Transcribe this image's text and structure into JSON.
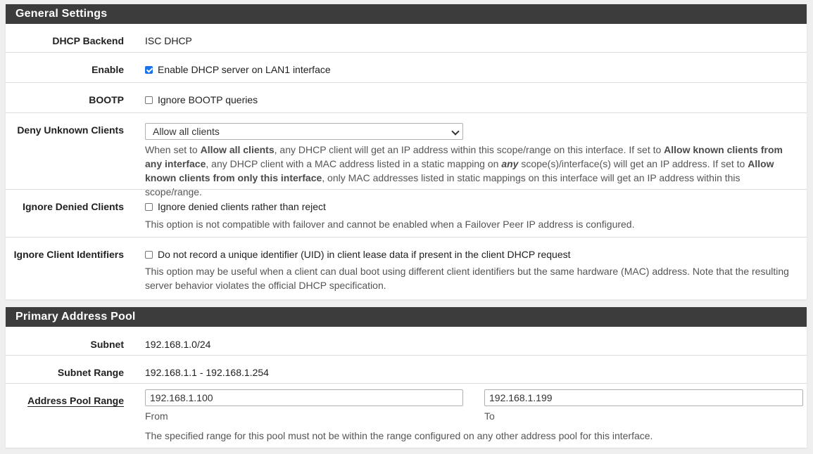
{
  "general": {
    "heading": "General Settings",
    "backend": {
      "label": "DHCP Backend",
      "value": "ISC DHCP"
    },
    "enable": {
      "label": "Enable",
      "checkbox_label": "Enable DHCP server on LAN1 interface",
      "checked": true
    },
    "bootp": {
      "label": "BOOTP",
      "checkbox_label": "Ignore BOOTP queries",
      "checked": false
    },
    "deny_unknown": {
      "label": "Deny Unknown Clients",
      "selected": "Allow all clients",
      "help": {
        "t1": "When set to ",
        "b1": "Allow all clients",
        "t2": ", any DHCP client will get an IP address within this scope/range on this interface. If set to ",
        "b2": "Allow known clients from any interface",
        "t3": ", any DHCP client with a MAC address listed in a static mapping on ",
        "b3": "any",
        "t4": " scope(s)/interface(s) will get an IP address. If set to ",
        "b4": "Allow known clients from only this interface",
        "t5": ", only MAC addresses listed in static mappings on this interface will get an IP address within this scope/range."
      }
    },
    "ignore_denied": {
      "label": "Ignore Denied Clients",
      "checkbox_label": "Ignore denied clients rather than reject",
      "checked": false,
      "help": "This option is not compatible with failover and cannot be enabled when a Failover Peer IP address is configured."
    },
    "ignore_client_ids": {
      "label": "Ignore Client Identifiers",
      "checkbox_label": "Do not record a unique identifier (UID) in client lease data if present in the client DHCP request",
      "checked": false,
      "help": "This option may be useful when a client can dual boot using different client identifiers but the same hardware (MAC) address. Note that the resulting server behavior violates the official DHCP specification."
    }
  },
  "pool": {
    "heading": "Primary Address Pool",
    "subnet": {
      "label": "Subnet",
      "value": "192.168.1.0/24"
    },
    "subnet_range": {
      "label": "Subnet Range",
      "value": "192.168.1.1 - 192.168.1.254"
    },
    "address_pool_range": {
      "label": "Address Pool Range",
      "from_value": "192.168.1.100",
      "from_label": "From",
      "to_value": "192.168.1.199",
      "to_label": "To",
      "help": "The specified range for this pool must not be within the range configured on any other address pool for this interface."
    }
  }
}
